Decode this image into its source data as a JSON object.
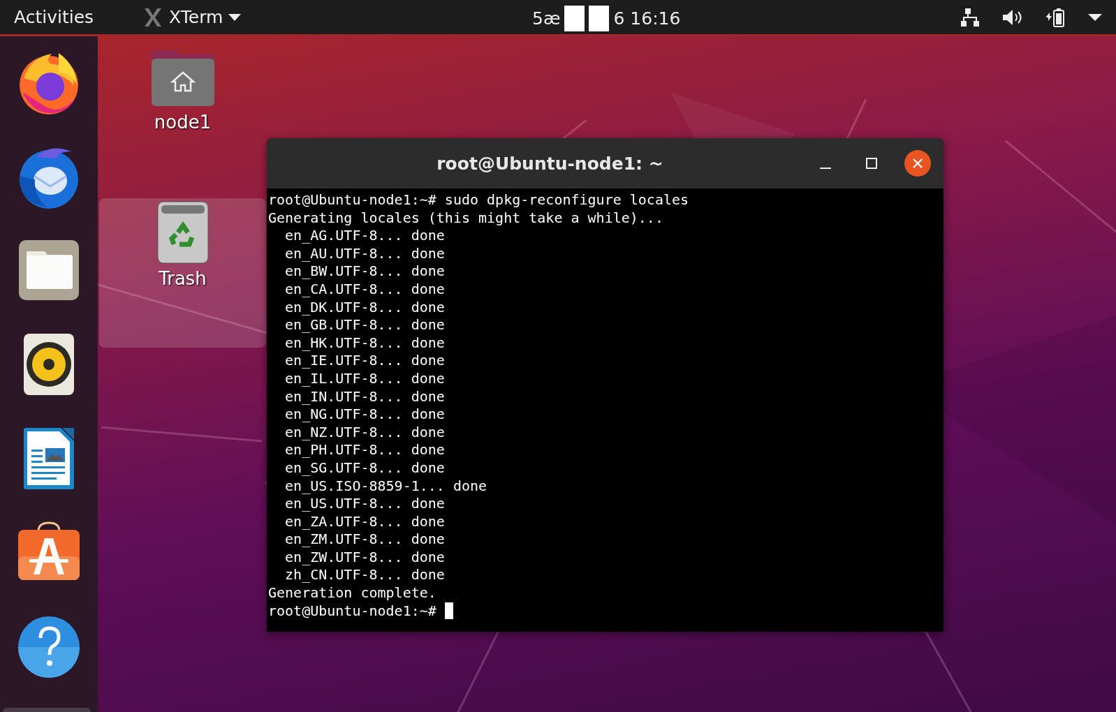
{
  "top_bar": {
    "activities": "Activities",
    "app_menu": "XTerm",
    "clock_prefix": "5æ",
    "clock_suffix": "6 16:16"
  },
  "dock": {
    "items": [
      {
        "kind": "firefox"
      },
      {
        "kind": "thunderbird"
      },
      {
        "kind": "files"
      },
      {
        "kind": "rhythmbox"
      },
      {
        "kind": "writer"
      },
      {
        "kind": "software"
      },
      {
        "kind": "help"
      }
    ]
  },
  "desktop_icons": [
    {
      "kind": "home",
      "label": "node1",
      "selected": false
    },
    {
      "kind": "trash",
      "label": "Trash",
      "selected": true
    }
  ],
  "terminal": {
    "title": "root@Ubuntu-node1: ~",
    "lines": [
      "root@Ubuntu-node1:~# sudo dpkg-reconfigure locales",
      "Generating locales (this might take a while)...",
      "  en_AG.UTF-8... done",
      "  en_AU.UTF-8... done",
      "  en_BW.UTF-8... done",
      "  en_CA.UTF-8... done",
      "  en_DK.UTF-8... done",
      "  en_GB.UTF-8... done",
      "  en_HK.UTF-8... done",
      "  en_IE.UTF-8... done",
      "  en_IL.UTF-8... done",
      "  en_IN.UTF-8... done",
      "  en_NG.UTF-8... done",
      "  en_NZ.UTF-8... done",
      "  en_PH.UTF-8... done",
      "  en_SG.UTF-8... done",
      "  en_US.ISO-8859-1... done",
      "  en_US.UTF-8... done",
      "  en_ZA.UTF-8... done",
      "  en_ZM.UTF-8... done",
      "  en_ZW.UTF-8... done",
      "  zh_CN.UTF-8... done",
      "Generation complete."
    ],
    "prompt": "root@Ubuntu-node1:~# "
  }
}
